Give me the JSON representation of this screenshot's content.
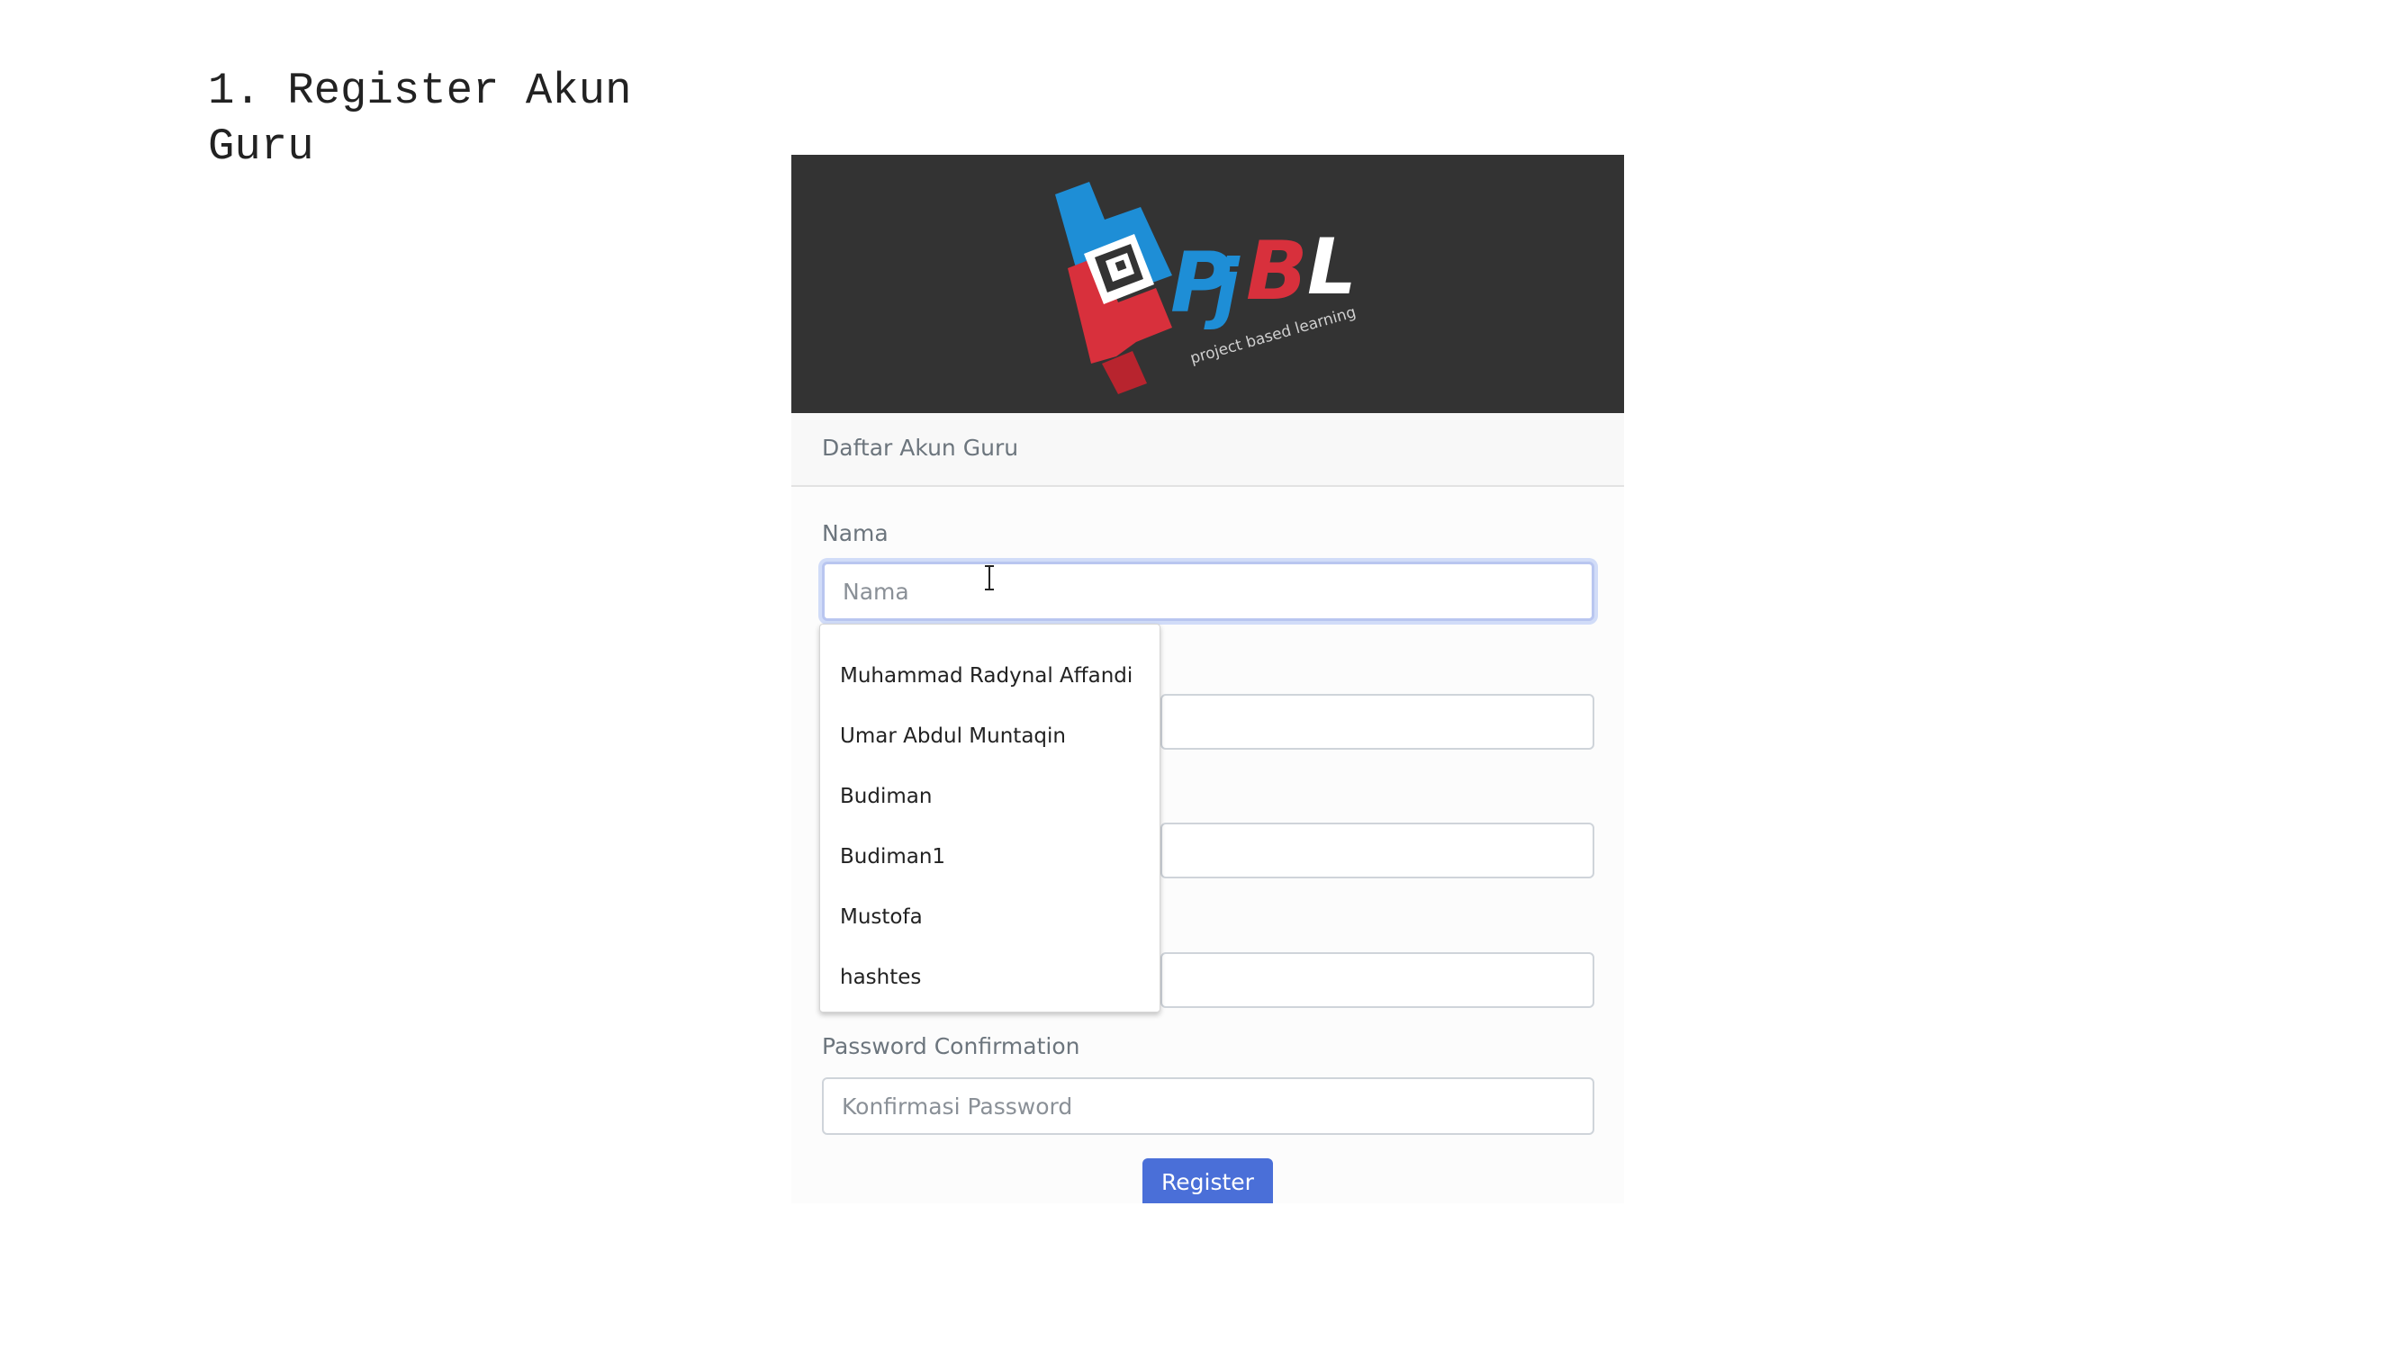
{
  "document": {
    "heading": "1. Register Akun\nGuru"
  },
  "form": {
    "header_title": "Daftar Akun Guru",
    "fields": {
      "nama": {
        "label": "Nama",
        "placeholder": "Nama",
        "value": ""
      },
      "password_confirmation": {
        "label": "Password Confirmation",
        "placeholder": "Konfirmasi Password",
        "value": ""
      }
    },
    "register_label": "Register"
  },
  "autocomplete": {
    "items": [
      "Muhammad Radynal Affandi",
      "Umar Abdul Muntaqin",
      "Budiman",
      "Budiman1",
      "Mustofa",
      "hashtes"
    ]
  },
  "logo": {
    "name": "pjbl-logo",
    "brand": "PjBL",
    "tagline": "project based learning",
    "colors": {
      "blue": "#1e8ed6",
      "red": "#d8303c",
      "white": "#ffffff",
      "background": "#333333"
    }
  },
  "colors": {
    "primary_button": "#4a6fd8",
    "focus_border": "#b9c6f0",
    "label_text": "#6c757d"
  }
}
